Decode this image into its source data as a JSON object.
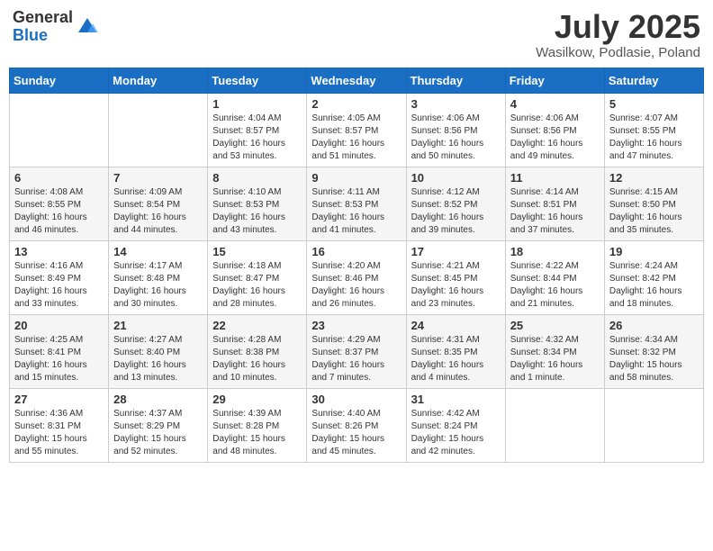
{
  "header": {
    "logo_general": "General",
    "logo_blue": "Blue",
    "month_year": "July 2025",
    "location": "Wasilkow, Podlasie, Poland"
  },
  "weekdays": [
    "Sunday",
    "Monday",
    "Tuesday",
    "Wednesday",
    "Thursday",
    "Friday",
    "Saturday"
  ],
  "weeks": [
    [
      {
        "day": "",
        "sunrise": "",
        "sunset": "",
        "daylight": ""
      },
      {
        "day": "",
        "sunrise": "",
        "sunset": "",
        "daylight": ""
      },
      {
        "day": "1",
        "sunrise": "Sunrise: 4:04 AM",
        "sunset": "Sunset: 8:57 PM",
        "daylight": "Daylight: 16 hours and 53 minutes."
      },
      {
        "day": "2",
        "sunrise": "Sunrise: 4:05 AM",
        "sunset": "Sunset: 8:57 PM",
        "daylight": "Daylight: 16 hours and 51 minutes."
      },
      {
        "day": "3",
        "sunrise": "Sunrise: 4:06 AM",
        "sunset": "Sunset: 8:56 PM",
        "daylight": "Daylight: 16 hours and 50 minutes."
      },
      {
        "day": "4",
        "sunrise": "Sunrise: 4:06 AM",
        "sunset": "Sunset: 8:56 PM",
        "daylight": "Daylight: 16 hours and 49 minutes."
      },
      {
        "day": "5",
        "sunrise": "Sunrise: 4:07 AM",
        "sunset": "Sunset: 8:55 PM",
        "daylight": "Daylight: 16 hours and 47 minutes."
      }
    ],
    [
      {
        "day": "6",
        "sunrise": "Sunrise: 4:08 AM",
        "sunset": "Sunset: 8:55 PM",
        "daylight": "Daylight: 16 hours and 46 minutes."
      },
      {
        "day": "7",
        "sunrise": "Sunrise: 4:09 AM",
        "sunset": "Sunset: 8:54 PM",
        "daylight": "Daylight: 16 hours and 44 minutes."
      },
      {
        "day": "8",
        "sunrise": "Sunrise: 4:10 AM",
        "sunset": "Sunset: 8:53 PM",
        "daylight": "Daylight: 16 hours and 43 minutes."
      },
      {
        "day": "9",
        "sunrise": "Sunrise: 4:11 AM",
        "sunset": "Sunset: 8:53 PM",
        "daylight": "Daylight: 16 hours and 41 minutes."
      },
      {
        "day": "10",
        "sunrise": "Sunrise: 4:12 AM",
        "sunset": "Sunset: 8:52 PM",
        "daylight": "Daylight: 16 hours and 39 minutes."
      },
      {
        "day": "11",
        "sunrise": "Sunrise: 4:14 AM",
        "sunset": "Sunset: 8:51 PM",
        "daylight": "Daylight: 16 hours and 37 minutes."
      },
      {
        "day": "12",
        "sunrise": "Sunrise: 4:15 AM",
        "sunset": "Sunset: 8:50 PM",
        "daylight": "Daylight: 16 hours and 35 minutes."
      }
    ],
    [
      {
        "day": "13",
        "sunrise": "Sunrise: 4:16 AM",
        "sunset": "Sunset: 8:49 PM",
        "daylight": "Daylight: 16 hours and 33 minutes."
      },
      {
        "day": "14",
        "sunrise": "Sunrise: 4:17 AM",
        "sunset": "Sunset: 8:48 PM",
        "daylight": "Daylight: 16 hours and 30 minutes."
      },
      {
        "day": "15",
        "sunrise": "Sunrise: 4:18 AM",
        "sunset": "Sunset: 8:47 PM",
        "daylight": "Daylight: 16 hours and 28 minutes."
      },
      {
        "day": "16",
        "sunrise": "Sunrise: 4:20 AM",
        "sunset": "Sunset: 8:46 PM",
        "daylight": "Daylight: 16 hours and 26 minutes."
      },
      {
        "day": "17",
        "sunrise": "Sunrise: 4:21 AM",
        "sunset": "Sunset: 8:45 PM",
        "daylight": "Daylight: 16 hours and 23 minutes."
      },
      {
        "day": "18",
        "sunrise": "Sunrise: 4:22 AM",
        "sunset": "Sunset: 8:44 PM",
        "daylight": "Daylight: 16 hours and 21 minutes."
      },
      {
        "day": "19",
        "sunrise": "Sunrise: 4:24 AM",
        "sunset": "Sunset: 8:42 PM",
        "daylight": "Daylight: 16 hours and 18 minutes."
      }
    ],
    [
      {
        "day": "20",
        "sunrise": "Sunrise: 4:25 AM",
        "sunset": "Sunset: 8:41 PM",
        "daylight": "Daylight: 16 hours and 15 minutes."
      },
      {
        "day": "21",
        "sunrise": "Sunrise: 4:27 AM",
        "sunset": "Sunset: 8:40 PM",
        "daylight": "Daylight: 16 hours and 13 minutes."
      },
      {
        "day": "22",
        "sunrise": "Sunrise: 4:28 AM",
        "sunset": "Sunset: 8:38 PM",
        "daylight": "Daylight: 16 hours and 10 minutes."
      },
      {
        "day": "23",
        "sunrise": "Sunrise: 4:29 AM",
        "sunset": "Sunset: 8:37 PM",
        "daylight": "Daylight: 16 hours and 7 minutes."
      },
      {
        "day": "24",
        "sunrise": "Sunrise: 4:31 AM",
        "sunset": "Sunset: 8:35 PM",
        "daylight": "Daylight: 16 hours and 4 minutes."
      },
      {
        "day": "25",
        "sunrise": "Sunrise: 4:32 AM",
        "sunset": "Sunset: 8:34 PM",
        "daylight": "Daylight: 16 hours and 1 minute."
      },
      {
        "day": "26",
        "sunrise": "Sunrise: 4:34 AM",
        "sunset": "Sunset: 8:32 PM",
        "daylight": "Daylight: 15 hours and 58 minutes."
      }
    ],
    [
      {
        "day": "27",
        "sunrise": "Sunrise: 4:36 AM",
        "sunset": "Sunset: 8:31 PM",
        "daylight": "Daylight: 15 hours and 55 minutes."
      },
      {
        "day": "28",
        "sunrise": "Sunrise: 4:37 AM",
        "sunset": "Sunset: 8:29 PM",
        "daylight": "Daylight: 15 hours and 52 minutes."
      },
      {
        "day": "29",
        "sunrise": "Sunrise: 4:39 AM",
        "sunset": "Sunset: 8:28 PM",
        "daylight": "Daylight: 15 hours and 48 minutes."
      },
      {
        "day": "30",
        "sunrise": "Sunrise: 4:40 AM",
        "sunset": "Sunset: 8:26 PM",
        "daylight": "Daylight: 15 hours and 45 minutes."
      },
      {
        "day": "31",
        "sunrise": "Sunrise: 4:42 AM",
        "sunset": "Sunset: 8:24 PM",
        "daylight": "Daylight: 15 hours and 42 minutes."
      },
      {
        "day": "",
        "sunrise": "",
        "sunset": "",
        "daylight": ""
      },
      {
        "day": "",
        "sunrise": "",
        "sunset": "",
        "daylight": ""
      }
    ]
  ]
}
